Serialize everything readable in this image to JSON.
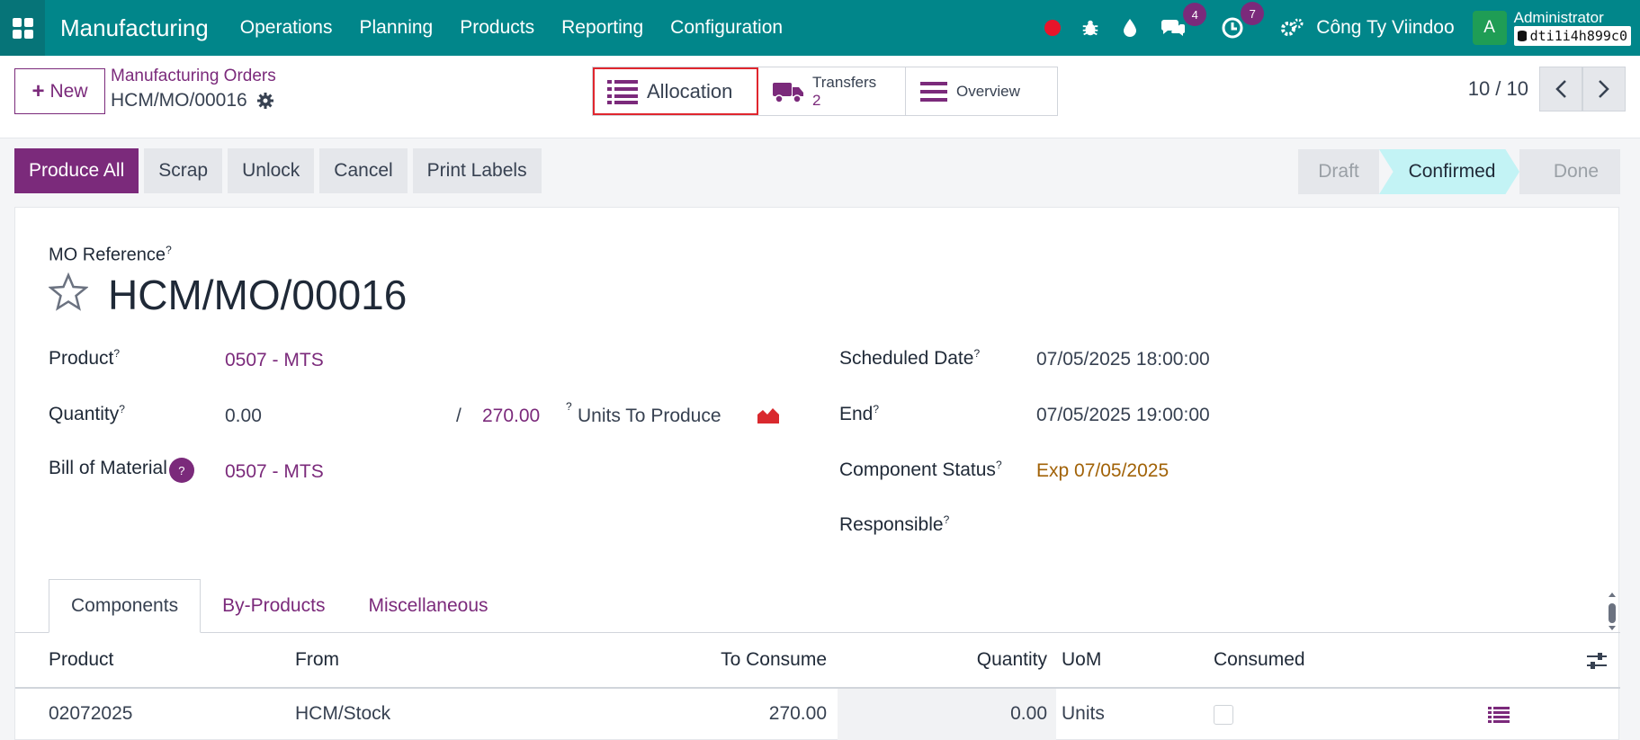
{
  "navbar": {
    "app_name": "Manufacturing",
    "menu": [
      "Operations",
      "Planning",
      "Products",
      "Reporting",
      "Configuration"
    ],
    "messages_count": "4",
    "activities_count": "7",
    "company": "Công Ty Viindoo",
    "avatar_letter": "A",
    "user": "Administrator",
    "database": "dti1i4h899c0",
    "accent_color": "#01868a"
  },
  "control": {
    "new_label": "New",
    "breadcrumb_parent": "Manufacturing Orders",
    "breadcrumb_current": "HCM/MO/00016",
    "smart": {
      "allocation": "Allocation",
      "transfers": "Transfers",
      "transfers_count": "2",
      "overview": "Overview"
    },
    "pager": "10 / 10"
  },
  "actions": {
    "produce_all": "Produce All",
    "scrap": "Scrap",
    "unlock": "Unlock",
    "cancel": "Cancel",
    "print_labels": "Print Labels"
  },
  "status": {
    "steps": [
      "Draft",
      "Confirmed",
      "Done"
    ],
    "current": "Confirmed"
  },
  "form": {
    "ref_label": "MO Reference",
    "help_mark": "?",
    "name": "HCM/MO/00016",
    "product_label": "Product",
    "product": "0507 - MTS",
    "quantity_label": "Quantity",
    "qty_produced": "0.00",
    "qty_separator": "/",
    "qty_total": "270.00",
    "qty_unit_text": "Units To Produce",
    "bom_label": "Bill of Material",
    "bom": "0507 - MTS",
    "scheduled_label": "Scheduled Date",
    "scheduled": "07/05/2025 18:00:00",
    "end_label": "End",
    "end": "07/05/2025 19:00:00",
    "component_status_label": "Component Status",
    "component_status": "Exp 07/05/2025",
    "responsible_label": "Responsible"
  },
  "tabs": [
    "Components",
    "By-Products",
    "Miscellaneous"
  ],
  "table": {
    "headers": {
      "product": "Product",
      "from": "From",
      "to_consume": "To Consume",
      "quantity": "Quantity",
      "uom": "UoM",
      "consumed": "Consumed"
    },
    "rows": [
      {
        "product": "02072025",
        "from": "HCM/Stock",
        "to_consume": "270.00",
        "quantity": "0.00",
        "uom": "Units",
        "consumed": false
      }
    ]
  }
}
